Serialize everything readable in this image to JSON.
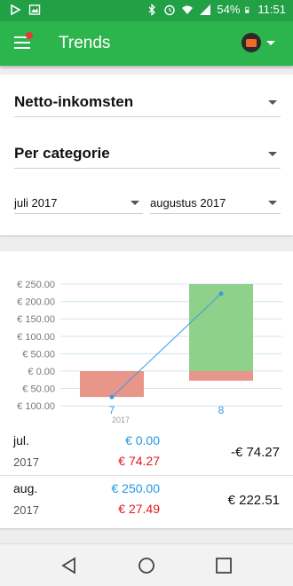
{
  "status_bar": {
    "battery": "54%",
    "time": "11:51",
    "icons": [
      "play-store-icon",
      "image-icon",
      "bluetooth-icon",
      "alarm-icon",
      "wifi-icon",
      "signal-icon",
      "battery-icon"
    ]
  },
  "app_bar": {
    "title": "Trends",
    "menu_icon": "hamburger-icon",
    "notification_dot_color": "#e53935",
    "account_icon": "wallet-icon"
  },
  "filters": {
    "metric": "Netto-inkomsten",
    "grouping": "Per categorie",
    "from": "juli 2017",
    "to": "augustus 2017"
  },
  "chart_data": {
    "type": "bar",
    "y_tick_labels": [
      "€ 250.00",
      "€ 200.00",
      "€ 150.00",
      "€ 100.00",
      "€ 50.00",
      "€ 0.00",
      "€ 50.00",
      "€ 100.00"
    ],
    "y_ticks": [
      250,
      200,
      150,
      100,
      50,
      0,
      -50,
      -100
    ],
    "ylim": [
      -100,
      250
    ],
    "categories": [
      "7",
      "8"
    ],
    "x_sublabels": [
      "2017",
      ""
    ],
    "income": [
      0.0,
      250.0
    ],
    "expenses": [
      74.27,
      27.49
    ],
    "net_line": [
      -74.27,
      222.51
    ],
    "colors": {
      "income": "#8fd18a",
      "expense": "#e8968a",
      "line": "#3a9be0",
      "grid": "#cfe4f5"
    },
    "grid": true
  },
  "summary": [
    {
      "month": "jul.",
      "year": "2017",
      "income": "€ 0.00",
      "expense": "€ 74.27",
      "net": "-€ 74.27"
    },
    {
      "month": "aug.",
      "year": "2017",
      "income": "€ 250.00",
      "expense": "€ 27.49",
      "net": "€ 222.51"
    }
  ],
  "nav_bar": {
    "icons": [
      "back-icon",
      "home-icon",
      "recents-icon"
    ]
  }
}
